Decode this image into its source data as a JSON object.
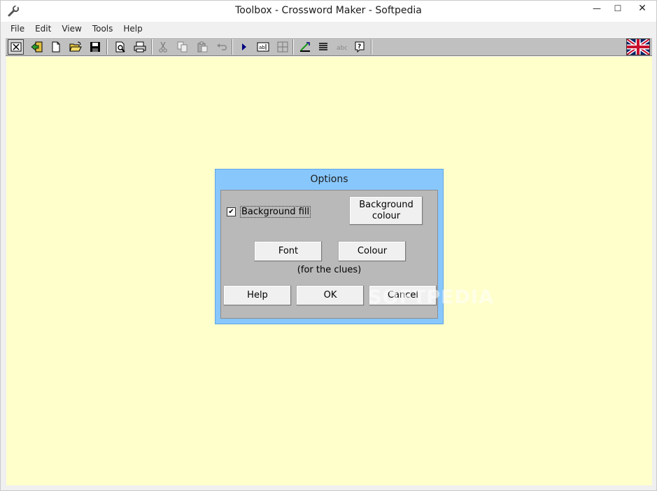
{
  "window": {
    "title": "Toolbox - Crossword Maker - Softpedia",
    "controls": {
      "minimize": "—",
      "maximize": "☐",
      "close": "✕"
    }
  },
  "menu": [
    "File",
    "Edit",
    "View",
    "Tools",
    "Help"
  ],
  "toolbar": {
    "icons": [
      "close-doc-icon",
      "exit-icon",
      "new-file-icon",
      "open-folder-icon",
      "save-icon",
      "print-preview-icon",
      "print-icon",
      "cut-icon",
      "copy-icon",
      "paste-icon",
      "undo-icon",
      "play-icon",
      "text-box-icon",
      "grid-icon",
      "ruler-icon",
      "lines-icon",
      "abc-icon",
      "help-icon"
    ],
    "language_flag": "uk-flag-icon"
  },
  "colors": {
    "workspace": "#ffffcc",
    "dialog_frame": "#88c7fc",
    "dialog_body": "#b9b9b9",
    "toolbar": "#c0c0c0"
  },
  "dialog": {
    "title": "Options",
    "background_fill": {
      "label": "Background fill",
      "checked": true,
      "mark": "✔"
    },
    "background_colour_label": "Background\ncolour",
    "font_label": "Font",
    "colour_label": "Colour",
    "note": "(for the clues)",
    "help_label": "Help",
    "ok_label": "OK",
    "cancel_label": "Cancel"
  },
  "watermark": "SOFTPEDIA"
}
